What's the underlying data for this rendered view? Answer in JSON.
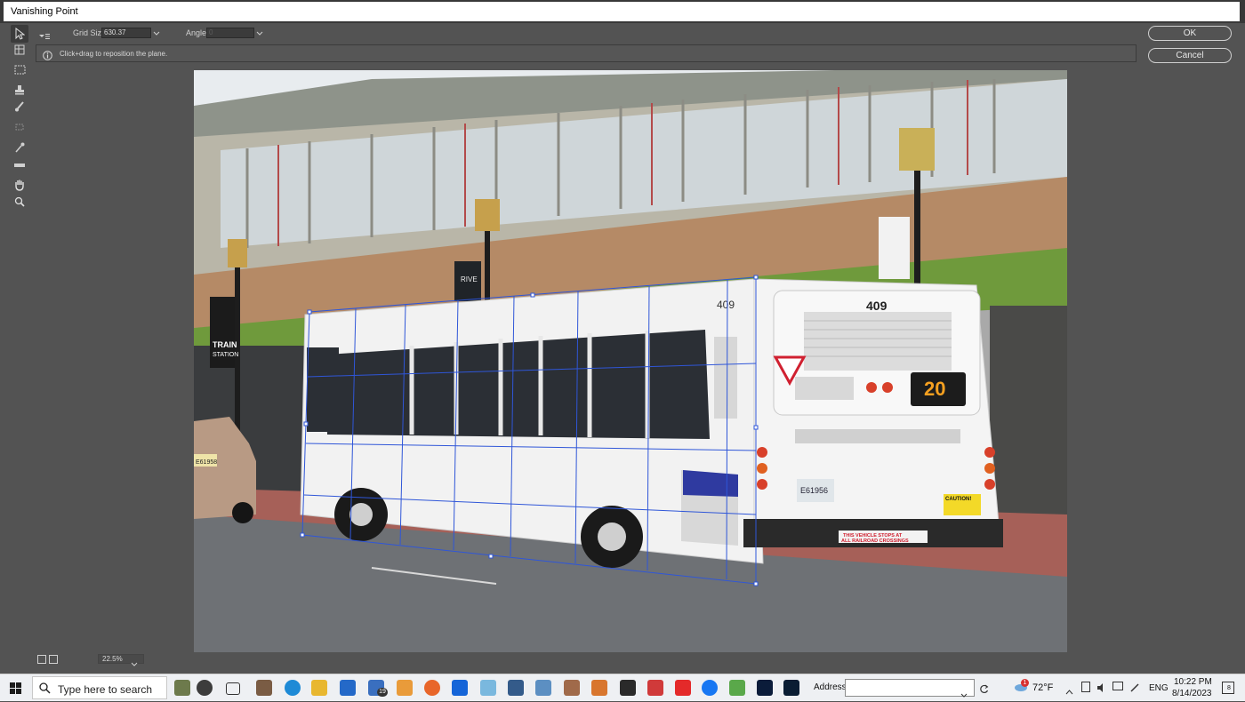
{
  "window": {
    "title": "Vanishing Point"
  },
  "options": {
    "grid_size_label": "Grid Size:",
    "grid_size_value": "630.37",
    "angle_label": "Angle:",
    "angle_value": "0"
  },
  "info": {
    "hint": "Click+drag to reposition the plane."
  },
  "buttons": {
    "ok": "OK",
    "cancel": "Cancel"
  },
  "status": {
    "zoom": "22.5%"
  },
  "photo": {
    "bus_number": "409",
    "route_number": "20",
    "plate": "E61956",
    "plate_small": "E61958",
    "sign_train": "TRAIN",
    "sign_station": "STATION",
    "bumper_line1": "THIS VEHICLE STOPS AT",
    "bumper_line2": "ALL RAILROAD CROSSINGS",
    "caution": "CAUTION!",
    "banner": "RIVE"
  },
  "taskbar": {
    "search_placeholder": "Type here to search",
    "mail_badge": "19",
    "address_label": "Address",
    "weather": "72°F",
    "weather_badge": "1",
    "lang": "ENG",
    "time": "10:22 PM",
    "date": "8/14/2023",
    "notif_count": "8"
  },
  "colors": {
    "panel": "#535353",
    "accent_blue": "#2f56d8",
    "led": "#f5a020"
  }
}
